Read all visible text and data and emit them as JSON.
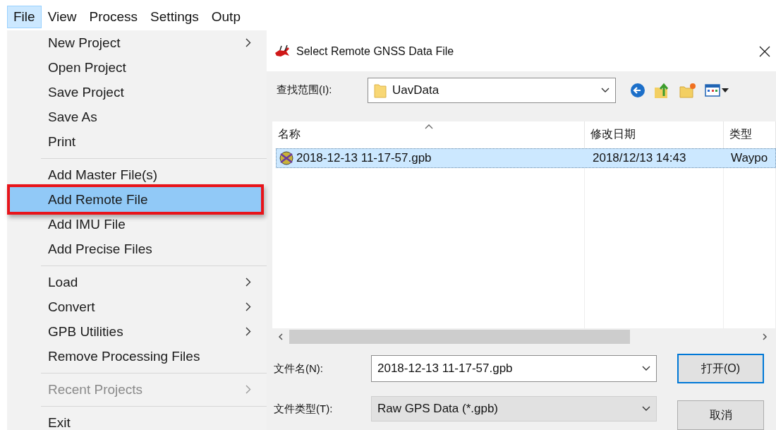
{
  "menubar": [
    {
      "label": "File",
      "selected": true
    },
    {
      "label": "View",
      "selected": false
    },
    {
      "label": "Process",
      "selected": false
    },
    {
      "label": "Settings",
      "selected": false
    },
    {
      "label": "Outp",
      "selected": false
    }
  ],
  "menu": {
    "items": [
      {
        "kind": "item",
        "label": "New Project",
        "submenu": true,
        "disabled": false,
        "selected": false,
        "annotated": false
      },
      {
        "kind": "item",
        "label": "Open Project",
        "submenu": false,
        "disabled": false,
        "selected": false,
        "annotated": false
      },
      {
        "kind": "item",
        "label": "Save Project",
        "submenu": false,
        "disabled": false,
        "selected": false,
        "annotated": false
      },
      {
        "kind": "item",
        "label": "Save As",
        "submenu": false,
        "disabled": false,
        "selected": false,
        "annotated": false
      },
      {
        "kind": "item",
        "label": "Print",
        "submenu": false,
        "disabled": false,
        "selected": false,
        "annotated": false
      },
      {
        "kind": "separator"
      },
      {
        "kind": "item",
        "label": "Add Master File(s)",
        "submenu": false,
        "disabled": false,
        "selected": false,
        "annotated": false
      },
      {
        "kind": "item",
        "label": "Add Remote File",
        "submenu": false,
        "disabled": false,
        "selected": true,
        "annotated": true
      },
      {
        "kind": "item",
        "label": "Add IMU File",
        "submenu": false,
        "disabled": false,
        "selected": false,
        "annotated": false
      },
      {
        "kind": "item",
        "label": "Add Precise Files",
        "submenu": false,
        "disabled": false,
        "selected": false,
        "annotated": false
      },
      {
        "kind": "separator"
      },
      {
        "kind": "item",
        "label": "Load",
        "submenu": true,
        "disabled": false,
        "selected": false,
        "annotated": false
      },
      {
        "kind": "item",
        "label": "Convert",
        "submenu": true,
        "disabled": false,
        "selected": false,
        "annotated": false
      },
      {
        "kind": "item",
        "label": "GPB Utilities",
        "submenu": true,
        "disabled": false,
        "selected": false,
        "annotated": false
      },
      {
        "kind": "item",
        "label": "Remove Processing Files",
        "submenu": false,
        "disabled": false,
        "selected": false,
        "annotated": false
      },
      {
        "kind": "separator"
      },
      {
        "kind": "item",
        "label": "Recent Projects",
        "submenu": true,
        "disabled": true,
        "selected": false,
        "annotated": false
      },
      {
        "kind": "separator"
      },
      {
        "kind": "item",
        "label": "Exit",
        "submenu": false,
        "disabled": false,
        "selected": false,
        "annotated": false
      }
    ]
  },
  "dialog": {
    "title": "Select Remote GNSS Data File",
    "look_in": {
      "label": "查找范围(I):",
      "value": "UavData"
    },
    "columns": [
      "名称",
      "修改日期",
      "类型"
    ],
    "rows": [
      {
        "name": "2018-12-13 11-17-57.gpb",
        "modified": "2018/12/13 14:43",
        "type": "Waypo",
        "selected": true
      }
    ],
    "file_name": {
      "label": "文件名(N):",
      "value": "2018-12-13 11-17-57.gpb"
    },
    "file_type": {
      "label": "文件类型(T):",
      "value": "Raw GPS Data (*.gpb)"
    },
    "buttons": [
      {
        "label": "打开(O)",
        "default": true
      },
      {
        "label": "取消",
        "default": false
      }
    ]
  }
}
